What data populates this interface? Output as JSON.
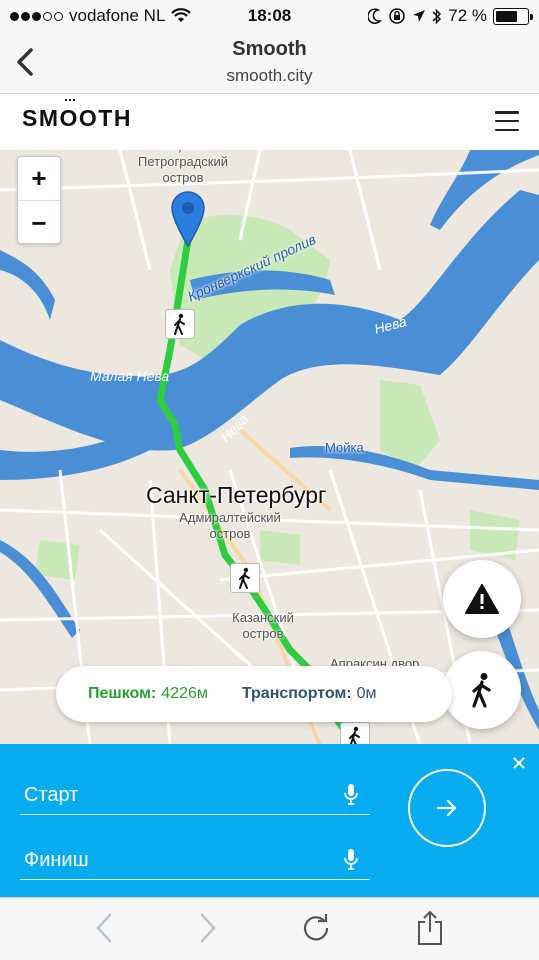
{
  "status_bar": {
    "signal_dots_filled": 3,
    "signal_dots_total": 5,
    "carrier": "vodafone NL",
    "time": "18:08",
    "battery": "72 %",
    "battery_level": 0.72,
    "icons": [
      "wifi-icon",
      "moon-icon",
      "orientation-lock-icon",
      "location-arrow-icon",
      "bluetooth-icon",
      "battery-icon"
    ]
  },
  "browser": {
    "title": "Smooth",
    "url": "smooth.city",
    "back_icon": "chevron-left-icon"
  },
  "app": {
    "logo": "SMOOTH",
    "logo_part1": "SM",
    "logo_o": "O",
    "logo_part2": "OTH",
    "menu_icon": "hamburger-icon"
  },
  "map": {
    "zoom_in": "+",
    "zoom_out": "−",
    "city_label": "Санкт-Петербург",
    "labels": {
      "petrograd": "сторона\nПетроградский\nостров",
      "kronverk": "Кронверкский пролив",
      "neva_right": "Нева",
      "malaya_neva": "Малая Нева",
      "neva_center": "Нева",
      "moika": "Мойка",
      "admiralty": "Адмиралтейский\nостров",
      "kazan": "Казанский\nостров",
      "apraksin": "Апраксин двор"
    },
    "route_color": "#2ecc40",
    "water_color": "#4a8fd6",
    "marker_icon": "map-pin-icon",
    "warning_icon": "warning-triangle-icon",
    "walk_icon": "pedestrian-icon"
  },
  "summary": {
    "walk_label": "Пешком:",
    "walk_value": "4226м",
    "transport_label": "Транспортом:",
    "transport_value": "0м"
  },
  "panel": {
    "start_placeholder": "Старт",
    "finish_placeholder": "Финиш",
    "mic_icon": "microphone-icon",
    "go_icon": "arrow-right-icon",
    "close_icon": "close-icon",
    "bg_color": "#07abf0"
  },
  "toolbar": {
    "icons": [
      "back-icon",
      "forward-icon",
      "reload-icon",
      "share-icon"
    ]
  }
}
